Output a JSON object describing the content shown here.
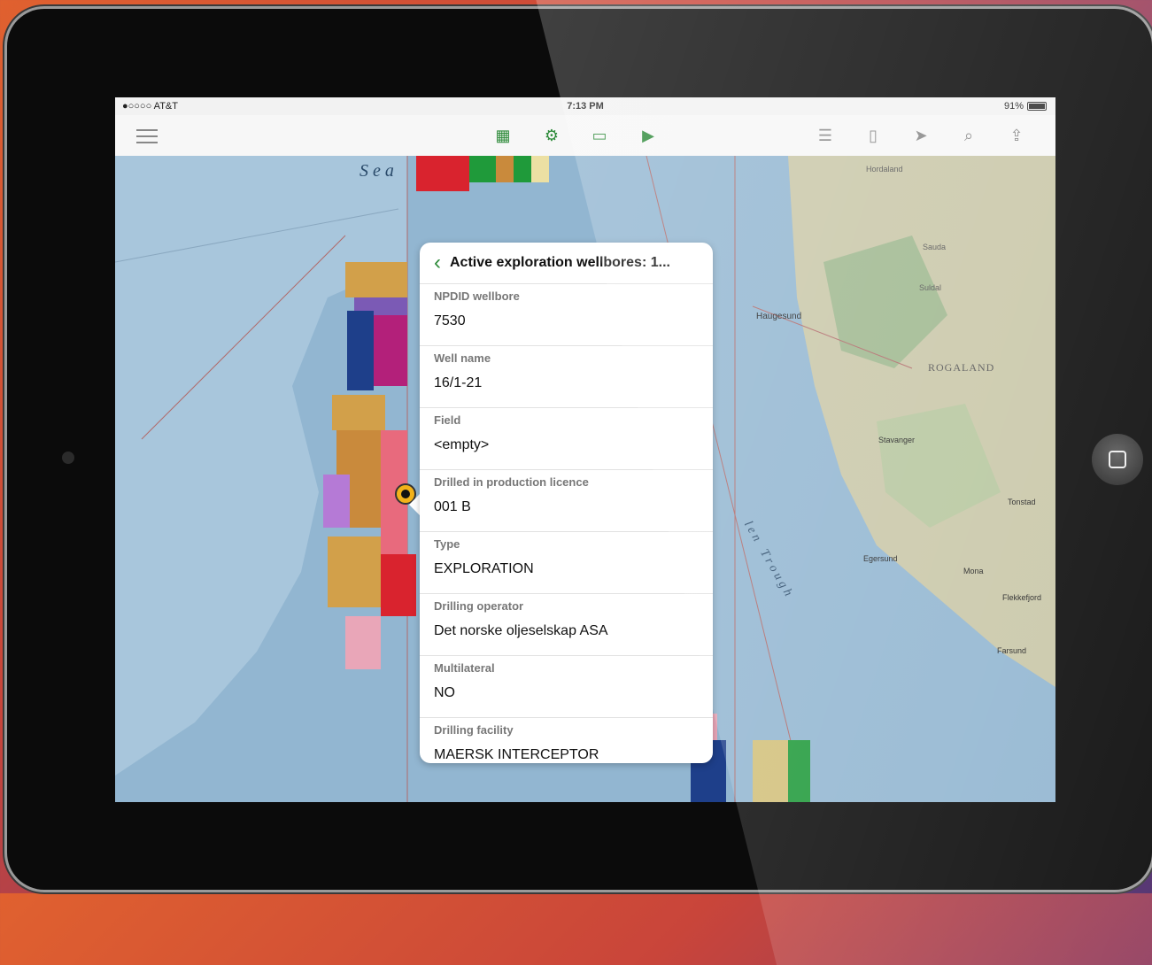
{
  "statusbar": {
    "carrier": "●○○○○ AT&T",
    "time": "7:13 PM",
    "battery": "91%"
  },
  "toolbar": {
    "icons": [
      "menu-icon",
      "basemap-icon",
      "layers-icon",
      "measure-icon",
      "presentation-icon",
      "legend-icon",
      "bookmarks-icon",
      "locate-icon",
      "search-icon",
      "share-icon"
    ]
  },
  "map": {
    "labels": {
      "sea": "S e a",
      "trench": "T r o u g h",
      "trench_prefix": "l e n",
      "haugesund": "Haugesund",
      "rogaland": "ROGALAND",
      "stavanger": "Stavanger",
      "egersund": "Egersund",
      "flekkefjord": "Flekkefjord",
      "farsund": "Farsund",
      "mandal": "Mona",
      "tonstad": "Tonstad",
      "sauda": "Sauda",
      "suldal": "Suldal",
      "hardanger": "Hordaland"
    },
    "colors": {
      "sea": "#92b6d1",
      "shelf": "#a8c6dc",
      "land": "#c9c7a8",
      "land_green": "#9fb88f"
    }
  },
  "callout": {
    "title": "Active exploration wellbores: 1...",
    "fields": [
      {
        "label": "NPDID wellbore",
        "value": "7530"
      },
      {
        "label": "Well name",
        "value": "16/1-21"
      },
      {
        "label": "Field",
        "value": "<empty>"
      },
      {
        "label": "Drilled in production licence",
        "value": "001 B"
      },
      {
        "label": "Type",
        "value": "EXPLORATION"
      },
      {
        "label": "Drilling operator",
        "value": "Det norske oljeselskap ASA"
      },
      {
        "label": "Multilateral",
        "value": "NO"
      },
      {
        "label": "Drilling facility",
        "value": "MAERSK INTERCEPTOR"
      }
    ]
  }
}
